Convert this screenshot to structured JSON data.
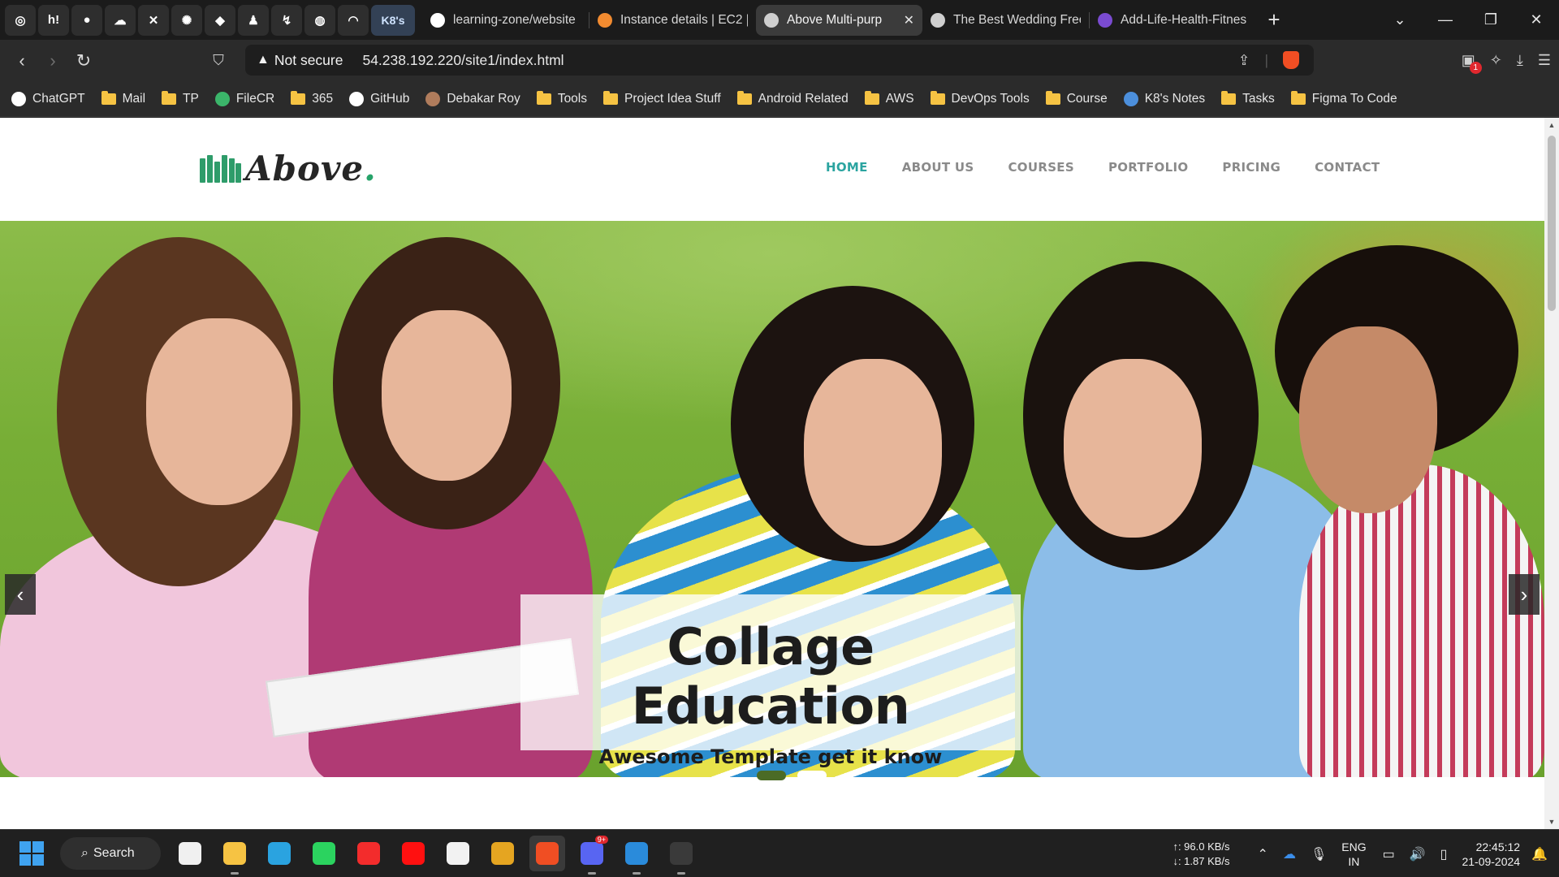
{
  "browser": {
    "pinned_tabs": [
      {
        "icon": "chatgpt-icon",
        "glyph": "◎"
      },
      {
        "icon": "hashnode-icon",
        "glyph": "h!"
      },
      {
        "icon": "github-icon",
        "glyph": "●"
      },
      {
        "icon": "cloudflare-icon",
        "glyph": "☁"
      },
      {
        "icon": "app-icon",
        "glyph": "✕"
      },
      {
        "icon": "claude-icon",
        "glyph": "✺"
      },
      {
        "icon": "figma-icon",
        "glyph": "◆"
      },
      {
        "icon": "tool-icon",
        "glyph": "♟"
      },
      {
        "icon": "zap-icon",
        "glyph": "↯"
      },
      {
        "icon": "globe-icon",
        "glyph": "◍"
      },
      {
        "icon": "cloud-icon",
        "glyph": "◠"
      }
    ],
    "active_pinned_label": "K8's",
    "tabs": [
      {
        "title": "learning-zone/website",
        "icon": "github-icon",
        "color": "#ffffff"
      },
      {
        "title": "Instance details | EC2 |",
        "icon": "aws-icon",
        "color": "#f28b30"
      },
      {
        "title": "Above Multi-purp",
        "icon": "globe-icon",
        "color": "#cfcfcf",
        "current": true,
        "close": "✕"
      },
      {
        "title": "The Best Wedding Free",
        "icon": "globe-icon",
        "color": "#cfcfcf"
      },
      {
        "title": "Add-Life-Health-Fitnes",
        "icon": "bootstrap-icon",
        "color": "#7a4bd1"
      }
    ],
    "new_tab": "+",
    "security_label": "Not secure",
    "url": "54.238.192.220/site1/index.html",
    "bookmarks": [
      {
        "label": "ChatGPT",
        "type": "site",
        "color": "#ffffff"
      },
      {
        "label": "Mail",
        "type": "folder"
      },
      {
        "label": "TP",
        "type": "folder"
      },
      {
        "label": "FileCR",
        "type": "site",
        "color": "#3bb56a"
      },
      {
        "label": "365",
        "type": "folder"
      },
      {
        "label": "GitHub",
        "type": "site",
        "color": "#ffffff"
      },
      {
        "label": "Debakar Roy",
        "type": "site",
        "color": "#b07c5c"
      },
      {
        "label": "Tools",
        "type": "folder"
      },
      {
        "label": "Project Idea Stuff",
        "type": "folder"
      },
      {
        "label": "Android Related",
        "type": "folder"
      },
      {
        "label": "AWS",
        "type": "folder"
      },
      {
        "label": "DevOps Tools",
        "type": "folder"
      },
      {
        "label": "Course",
        "type": "folder"
      },
      {
        "label": "K8's Notes",
        "type": "site",
        "color": "#4c8fdc"
      },
      {
        "label": "Tasks",
        "type": "folder"
      },
      {
        "label": "Figma To Code",
        "type": "folder"
      }
    ],
    "extension_badge": "1"
  },
  "site": {
    "logo_text": "Above",
    "logo_dot": ".",
    "nav": [
      "HOME",
      "ABOUT US",
      "COURSES",
      "PORTFOLIO",
      "PRICING",
      "CONTACT"
    ],
    "active_nav": "HOME",
    "accent_color": "#2ba4a0",
    "hero": {
      "title": "Collage Education",
      "subtitle": "Awesome Template get it know",
      "slides": 2,
      "active_slide": 2,
      "prev": "‹",
      "next": "›"
    }
  },
  "taskbar": {
    "search_label": "Search",
    "apps": [
      {
        "name": "microsoft-store-icon",
        "color": "#f0f0f0"
      },
      {
        "name": "file-explorer-icon",
        "color": "#f6c343",
        "running": true
      },
      {
        "name": "telegram-icon",
        "color": "#2aa3e0"
      },
      {
        "name": "whatsapp-icon",
        "color": "#2bd35f"
      },
      {
        "name": "youtube-music-icon",
        "color": "#f32c2c"
      },
      {
        "name": "youtube-icon",
        "color": "#ff1010"
      },
      {
        "name": "notion-icon",
        "color": "#f2f2f2"
      },
      {
        "name": "chrome-icon",
        "color": "#e5a521"
      },
      {
        "name": "brave-icon",
        "color": "#f04e23",
        "focused": true
      },
      {
        "name": "discord-icon",
        "color": "#5865f2",
        "running": true,
        "badge": "9+"
      },
      {
        "name": "vscode-icon",
        "color": "#2a8bdb",
        "running": true
      },
      {
        "name": "terminal-icon",
        "color": "#3a3a3a",
        "running": true
      }
    ],
    "upload_speed": "↑: 96.0 KB/s",
    "download_speed": "↓: 1.87 KB/s",
    "lang_line1": "ENG",
    "lang_line2": "IN",
    "time": "22:45:12",
    "date": "21-09-2024"
  }
}
